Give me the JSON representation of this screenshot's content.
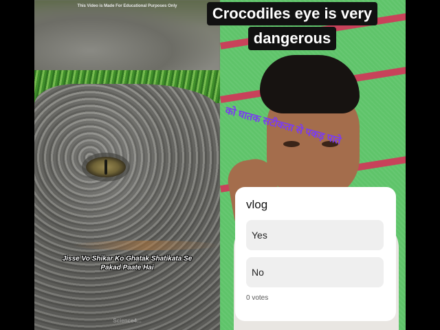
{
  "title": {
    "line1": "Crocodiles eye is very",
    "line2": "dangerous"
  },
  "left_video": {
    "watermark": "This Video is Made For Educational Purposes Only",
    "subtitle_line1": "Jisse Vo Shikar Ko Ghatak Shatikata Se",
    "subtitle_line2": "Pakad Paate Hai",
    "channel_mark": "Science4..."
  },
  "right_video": {
    "overlay_text": "को घातक सटीकता से पकड़ पाते"
  },
  "poll": {
    "question": "vlog",
    "options": [
      {
        "label": "Yes"
      },
      {
        "label": "No"
      }
    ],
    "votes_label": "0 votes"
  },
  "colors": {
    "overlay_text": "#7a3cf0",
    "wall_green": "#5fc46a",
    "wall_stripe": "#c8425a",
    "title_bg": "#111111",
    "poll_option_bg": "#efefef"
  }
}
